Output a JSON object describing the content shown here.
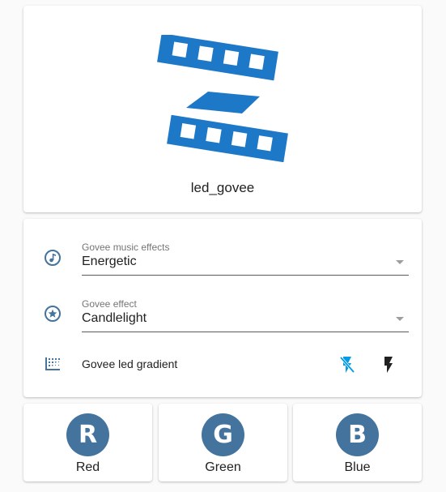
{
  "colors": {
    "accent": "#44739e",
    "logo_blue": "#1e78c8",
    "active_icon": "#039be5"
  },
  "logo_card": {
    "icon": "film-strip-logo-icon",
    "name": "led_govee"
  },
  "entities": {
    "music_effects": {
      "icon": "music-note-icon",
      "label": "Govee music effects",
      "value": "Energetic"
    },
    "effect": {
      "icon": "star-circle-icon",
      "label": "Govee effect",
      "value": "Candlelight"
    },
    "gradient": {
      "icon": "gradient-icon",
      "label": "Govee led gradient",
      "off_icon": "flash-off-icon",
      "on_icon": "flash-icon"
    }
  },
  "buttons": [
    {
      "letter": "R",
      "name": "Red"
    },
    {
      "letter": "G",
      "name": "Green"
    },
    {
      "letter": "B",
      "name": "Blue"
    }
  ]
}
